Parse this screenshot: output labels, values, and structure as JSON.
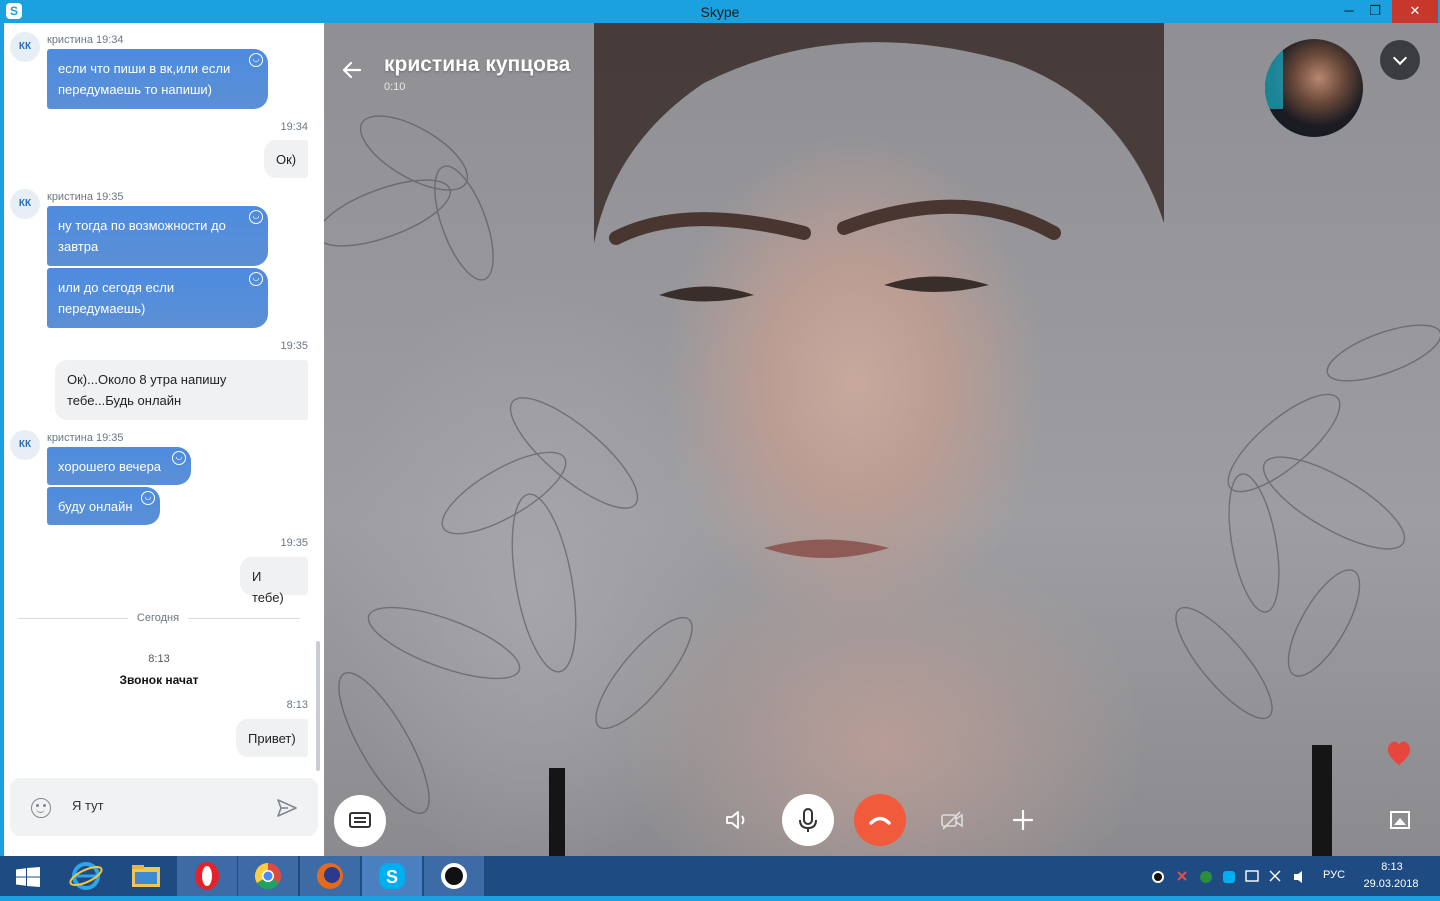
{
  "window": {
    "title": "Skype",
    "app_icon": "S",
    "minimize": "─",
    "maximize": "❐",
    "close": "✕"
  },
  "chat": {
    "avatar_initials": "КК",
    "groups": [
      {
        "meta": "кристина 19:34",
        "messages": [
          "если что пиши в вк,или если передумаешь то напиши)"
        ]
      },
      {
        "meta": "кристина 19:35",
        "messages": [
          "ну тогда по возможности до завтра",
          "или до сегодя если передумаешь)"
        ]
      },
      {
        "meta": "кристина 19:35",
        "messages": [
          "хорошего вечера",
          "буду онлайн"
        ]
      }
    ],
    "outgoing": [
      {
        "time": "19:34",
        "text": "Ок)"
      },
      {
        "time": "19:35",
        "text": "Ок)...Около 8 утра напишу тебе...Будь онлайн"
      },
      {
        "time": "19:35",
        "text": "И тебе)"
      },
      {
        "time": "8:13",
        "text": "Привет)"
      }
    ],
    "day_divider": "Сегодня",
    "call_event": {
      "time": "8:13",
      "text": "Звонок начат"
    },
    "composer": {
      "value": "Я тут"
    }
  },
  "call": {
    "contact_name": "кристина купцова",
    "timer": "0:10"
  },
  "taskbar": {
    "apps": [
      "windows-start-icon",
      "internet-explorer-icon",
      "file-explorer-icon",
      "opera-icon",
      "chrome-icon",
      "firefox-icon",
      "skype-icon",
      "recorder-icon"
    ],
    "language": "РУС",
    "time": "8:13",
    "date": "29.03.2018"
  },
  "colors": {
    "accent": "#1aa1e0",
    "bubble_in": "#4f89d6",
    "end_call": "#f15a3b",
    "taskbar": "#1f4b83"
  }
}
